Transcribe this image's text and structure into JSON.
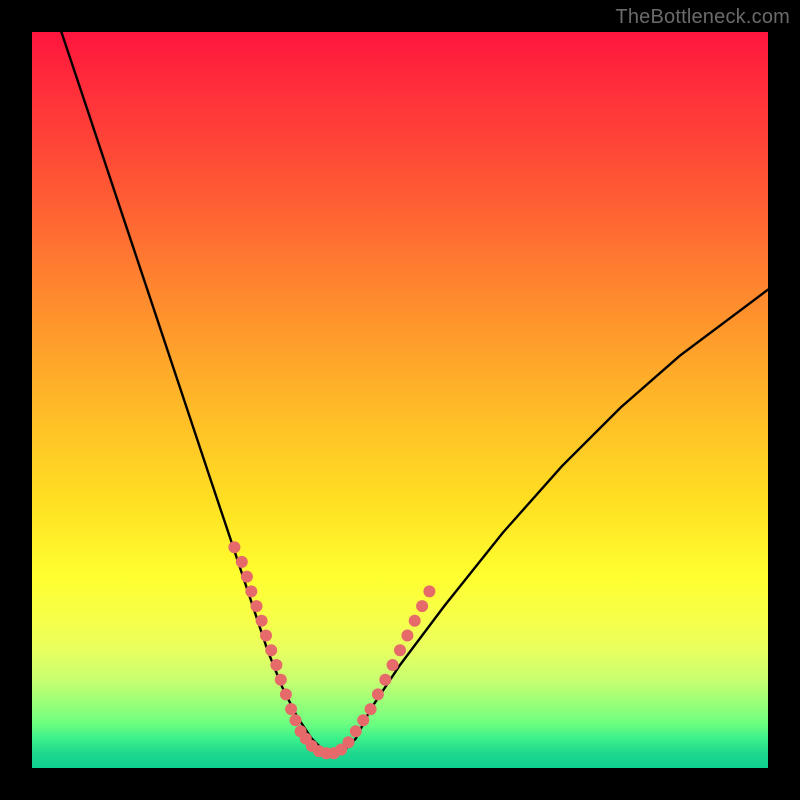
{
  "watermark": "TheBottleneck.com",
  "colors": {
    "frame": "#000000",
    "curve": "#000000",
    "dot": "#e66a6a"
  },
  "chart_data": {
    "type": "line",
    "title": "",
    "xlabel": "",
    "ylabel": "",
    "xlim": [
      0,
      100
    ],
    "ylim": [
      0,
      100
    ],
    "grid": false,
    "legend": false,
    "series": [
      {
        "name": "bottleneck-curve",
        "x": [
          4,
          8,
          12,
          16,
          20,
          24,
          26,
          28,
          30,
          32,
          34,
          36,
          38,
          40,
          42,
          44,
          46,
          50,
          56,
          64,
          72,
          80,
          88,
          96,
          100
        ],
        "y": [
          100,
          88,
          76,
          64,
          52,
          40,
          34,
          28,
          22,
          16,
          11,
          7,
          4,
          2,
          2,
          4,
          8,
          14,
          22,
          32,
          41,
          49,
          56,
          62,
          65
        ]
      }
    ],
    "highlight_points": {
      "name": "sampled-dots",
      "x": [
        27.5,
        28.5,
        29.2,
        29.8,
        30.5,
        31.2,
        31.8,
        32.5,
        33.2,
        33.8,
        34.5,
        35.2,
        35.8,
        36.5,
        37.2,
        38.0,
        39.0,
        40.0,
        41.0,
        42.0,
        43.0,
        44.0,
        45.0,
        46.0,
        47.0,
        48.0,
        49.0,
        50.0,
        51.0,
        52.0,
        53.0,
        54.0
      ],
      "y": [
        30,
        28,
        26,
        24,
        22,
        20,
        18,
        16,
        14,
        12,
        10,
        8,
        6.5,
        5,
        4,
        3,
        2.3,
        2,
        2,
        2.5,
        3.5,
        5,
        6.5,
        8,
        10,
        12,
        14,
        16,
        18,
        20,
        22,
        24
      ],
      "radius": 6
    }
  }
}
